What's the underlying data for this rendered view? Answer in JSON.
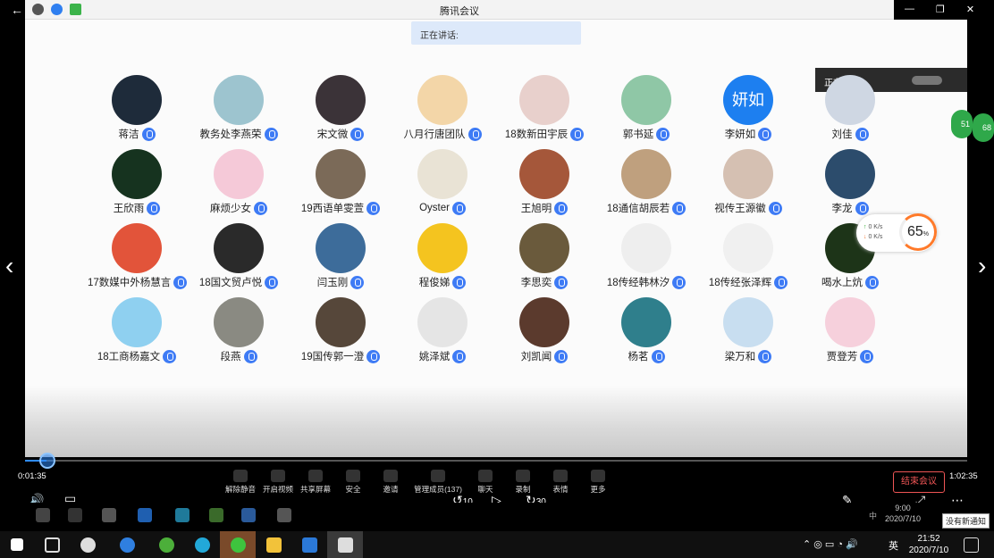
{
  "window": {
    "title": "腾讯会议"
  },
  "speaking_bar": {
    "label": "正在讲话:"
  },
  "speaking_panel": {
    "label": "正在讲话:"
  },
  "participants": [
    {
      "name": "蒋洁",
      "color": "#1e2b3a"
    },
    {
      "name": "教务处李燕荣",
      "color": "#9dc4cf"
    },
    {
      "name": "宋文微",
      "color": "#3b3338"
    },
    {
      "name": "八月行唐团队",
      "color": "#f3d6a8"
    },
    {
      "name": "18数新田宇辰",
      "color": "#e8d0cc"
    },
    {
      "name": "郭书延",
      "color": "#8fc7a6"
    },
    {
      "name": "李妍如",
      "color": "#1d7ff0",
      "initials": "妍如"
    },
    {
      "name": "刘佳",
      "color": "#cfd7e3"
    },
    {
      "name": "王欣雨",
      "color": "#16331f"
    },
    {
      "name": "麻烦少女",
      "color": "#f5c9d8"
    },
    {
      "name": "19西语单雯萱",
      "color": "#7b6a58"
    },
    {
      "name": "Oyster",
      "color": "#e9e3d5"
    },
    {
      "name": "王旭明",
      "color": "#a5573a"
    },
    {
      "name": "18通信胡辰若",
      "color": "#bfa07e"
    },
    {
      "name": "视传王源徽",
      "color": "#d5c0b2"
    },
    {
      "name": "李龙",
      "color": "#2c4c6c"
    },
    {
      "name": "17数媒中外杨慧言",
      "color": "#e2543a"
    },
    {
      "name": "18国文贸卢悦",
      "color": "#2a2a2a"
    },
    {
      "name": "闫玉刚",
      "color": "#3d6c9a"
    },
    {
      "name": "程俊娣",
      "color": "#f4c41f"
    },
    {
      "name": "李思奕",
      "color": "#6a5a3c"
    },
    {
      "name": "18传经韩林汐",
      "color": "#eeeeee"
    },
    {
      "name": "18传经张泽辉",
      "color": "#f0f0f0"
    },
    {
      "name": "喝水上炕",
      "color": "#1d3418"
    },
    {
      "name": "18工商杨嘉文",
      "color": "#8fd0f0"
    },
    {
      "name": "段燕",
      "color": "#8a8a82"
    },
    {
      "name": "19国传郭一澄",
      "color": "#56473a"
    },
    {
      "name": "姚泽斌",
      "color": "#e5e5e5"
    },
    {
      "name": "刘凯闻",
      "color": "#5b3a2d"
    },
    {
      "name": "杨茗",
      "color": "#2f7f8c"
    },
    {
      "name": "梁万和",
      "color": "#c8def0"
    },
    {
      "name": "贾登芳",
      "color": "#f6d0dc"
    }
  ],
  "network": {
    "up": "0 K/s",
    "down": "0 K/s",
    "percent": "65",
    "unit": "%"
  },
  "edge_badges": [
    "51",
    "68"
  ],
  "player": {
    "elapsed": "0:01:35",
    "total": "1:02:35",
    "progress_fraction": 0.025,
    "skip_back": "10",
    "skip_forward": "30"
  },
  "toolbar": [
    {
      "id": "mute",
      "label": "解除静音"
    },
    {
      "id": "video",
      "label": "开启视频"
    },
    {
      "id": "share",
      "label": "共享屏幕"
    },
    {
      "id": "security",
      "label": "安全"
    },
    {
      "id": "invite",
      "label": "邀请"
    },
    {
      "id": "members",
      "label": "管理成员(137)"
    },
    {
      "id": "chat",
      "label": "聊天"
    },
    {
      "id": "record",
      "label": "录制"
    },
    {
      "id": "emoji",
      "label": "表情"
    },
    {
      "id": "more",
      "label": "更多"
    }
  ],
  "end_meeting": "结束会议",
  "inner_clock": {
    "time": "9:00",
    "date": "2020/7/10"
  },
  "inner_tray_ime": "中",
  "notification_tooltip": "没有新通知",
  "taskbar": {
    "ime": "英",
    "time": "21:52",
    "date": "2020/7/10"
  }
}
